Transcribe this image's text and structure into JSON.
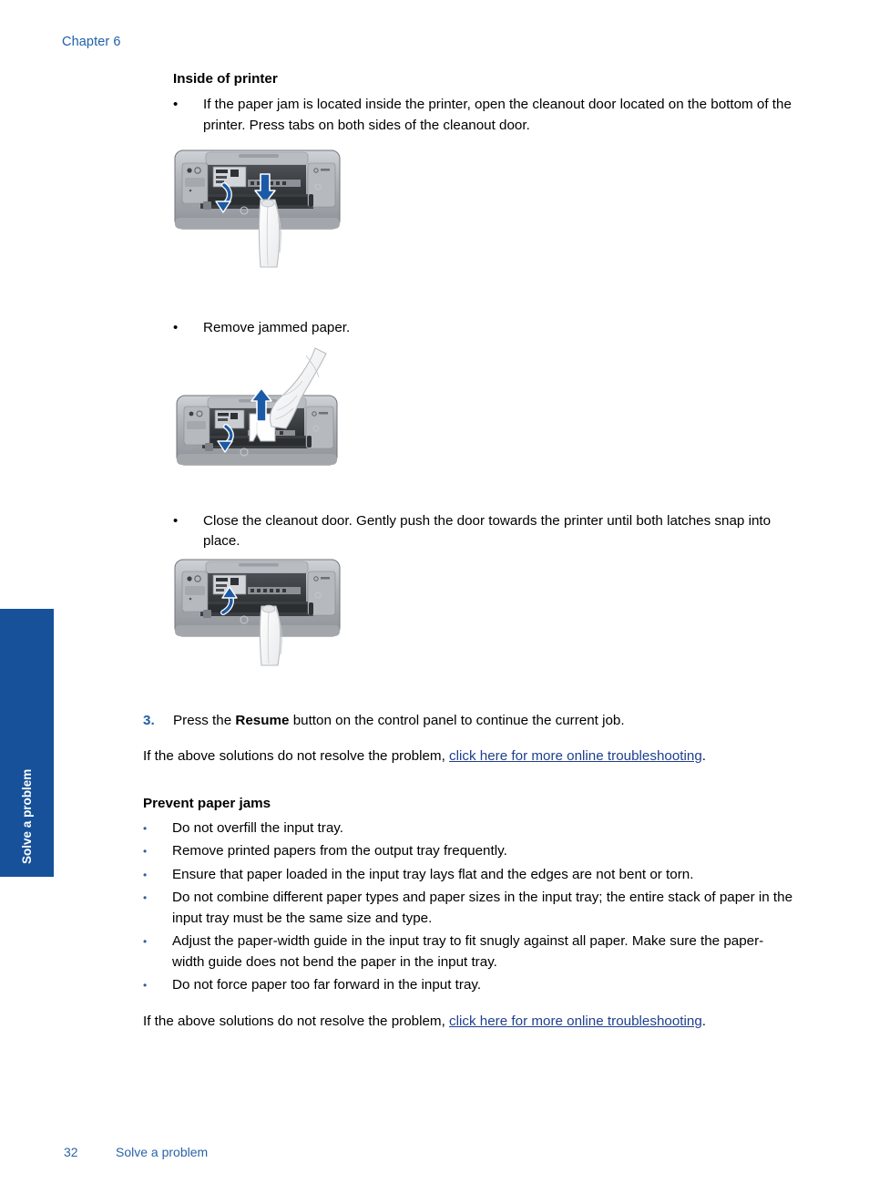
{
  "header": {
    "chapter": "Chapter 6"
  },
  "side_tab": {
    "label": "Solve a problem",
    "color": "#16519a"
  },
  "main": {
    "section_heading": "Inside of printer",
    "bullets": [
      {
        "marker": "•",
        "text": "If the paper jam is located inside the printer, open the cleanout door located on the bottom of the printer. Press tabs on both sides of the cleanout door."
      },
      {
        "marker": "•",
        "text": "Remove jammed paper."
      },
      {
        "marker": "•",
        "text": "Close the cleanout door. Gently push the door towards the printer until both latches snap into place."
      }
    ],
    "figures": [
      {
        "name": "printer-open-cleanout-door",
        "caption": "Printer front view with cleanout door opening downward, hand pressing tabs"
      },
      {
        "name": "printer-remove-jammed-paper",
        "caption": "Printer front view with hand pulling jammed paper upward out of the printer"
      },
      {
        "name": "printer-close-cleanout-door",
        "caption": "Printer front view with cleanout door closing upward, hand pushing door"
      }
    ],
    "step": {
      "number": "3.",
      "text_before_bold": "Press the ",
      "bold": "Resume",
      "text_after_bold": " button on the control panel to continue the current job."
    },
    "troubleshoot_paragraph": {
      "lead": "If the above solutions do not resolve the problem, ",
      "link": "click here for more online troubleshooting",
      "tail": "."
    },
    "prevent_heading": "Prevent paper jams",
    "prevent_bullets": [
      "Do not overfill the input tray.",
      "Remove printed papers from the output tray frequently.",
      "Ensure that paper loaded in the input tray lays flat and the edges are not bent or torn.",
      "Do not combine different paper types and paper sizes in the input tray; the entire stack of paper in the input tray must be the same size and type.",
      "Adjust the paper-width guide in the input tray to fit snugly against all paper. Make sure the paper-width guide does not bend the paper in the input tray.",
      "Do not force paper too far forward in the input tray."
    ],
    "bullet_marker": "•",
    "troubleshoot_paragraph_2": {
      "lead": "If the above solutions do not resolve the problem, ",
      "link": "click here for more online troubleshooting",
      "tail": "."
    }
  },
  "footer": {
    "page_number": "32",
    "section": "Solve a problem"
  },
  "colors": {
    "accent_blue": "#1f5fa9",
    "tab_blue": "#16519a",
    "link_blue": "#1f3f8f",
    "arrow_blue": "#1b5aa6",
    "printer_body": "#a9adb2"
  }
}
